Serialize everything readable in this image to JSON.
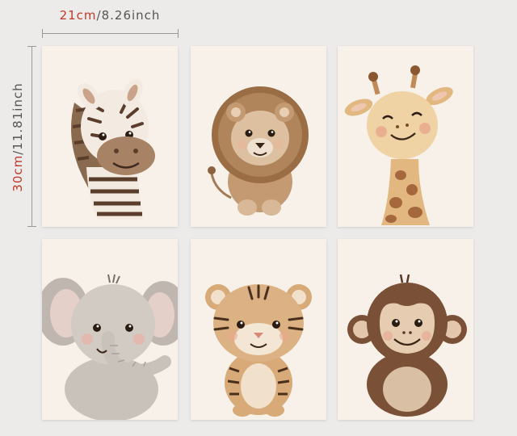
{
  "dimensions": {
    "width_cm": "21cm",
    "width_in": "/8.26inch",
    "height_cm": "30cm",
    "height_in": "/11.81inch"
  },
  "cards": [
    {
      "animal": "zebra"
    },
    {
      "animal": "lion"
    },
    {
      "animal": "giraffe"
    },
    {
      "animal": "elephant"
    },
    {
      "animal": "tiger"
    },
    {
      "animal": "monkey"
    }
  ],
  "colors": {
    "background": "#ecebe9",
    "card": "#f7f1ea",
    "dimension_red": "#c0392b",
    "dimension_gray": "#555555"
  }
}
